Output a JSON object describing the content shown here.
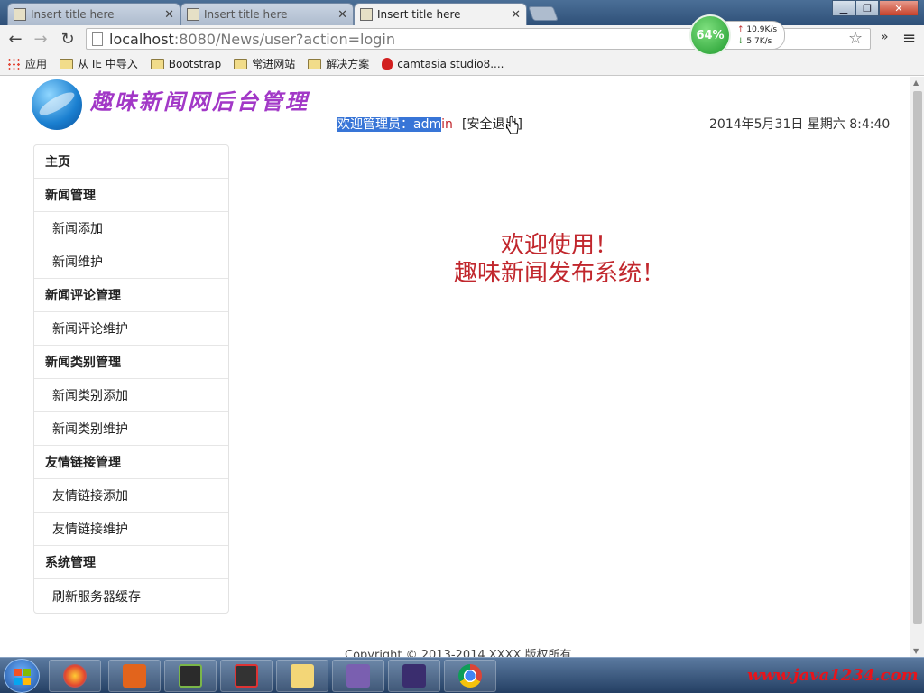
{
  "browser": {
    "tabs": [
      {
        "title": "Insert title here",
        "active": false
      },
      {
        "title": "Insert title here",
        "active": false
      },
      {
        "title": "Insert title here",
        "active": true
      }
    ],
    "url_host": "localhost",
    "url_path": ":8080/News/user?action=login",
    "bookmarks": [
      {
        "label": "应用",
        "icon": "apps-icon"
      },
      {
        "label": "从 IE 中导入",
        "icon": "folder-icon"
      },
      {
        "label": "Bootstrap",
        "icon": "folder-icon"
      },
      {
        "label": "常进网站",
        "icon": "folder-icon"
      },
      {
        "label": "解决方案",
        "icon": "folder-icon"
      },
      {
        "label": "camtasia studio8....",
        "icon": "camtasia-icon"
      }
    ],
    "speed_meter": {
      "percent": "64%",
      "up": "10.9K/s",
      "down": "5.7K/s"
    }
  },
  "header": {
    "site_title": "趣味新闻网后台管理",
    "welcome_selected": "欢迎管理员：adm",
    "welcome_rest": "in",
    "logout": "[安全退出]",
    "datetime": "2014年5月31日 星期六 8:4:40"
  },
  "sidebar": {
    "items": [
      {
        "label": "主页",
        "type": "header"
      },
      {
        "label": "新闻管理",
        "type": "header"
      },
      {
        "label": "新闻添加",
        "type": "sub"
      },
      {
        "label": "新闻维护",
        "type": "sub"
      },
      {
        "label": "新闻评论管理",
        "type": "header"
      },
      {
        "label": "新闻评论维护",
        "type": "sub"
      },
      {
        "label": "新闻类别管理",
        "type": "header"
      },
      {
        "label": "新闻类别添加",
        "type": "sub"
      },
      {
        "label": "新闻类别维护",
        "type": "sub"
      },
      {
        "label": "友情链接管理",
        "type": "header"
      },
      {
        "label": "友情链接添加",
        "type": "sub"
      },
      {
        "label": "友情链接维护",
        "type": "sub"
      },
      {
        "label": "系统管理",
        "type": "header"
      },
      {
        "label": "刷新服务器缓存",
        "type": "sub"
      }
    ]
  },
  "main": {
    "welcome_line1": "欢迎使用！",
    "welcome_line2": "趣味新闻发布系统！"
  },
  "footer": {
    "text": "Copyright © 2013-2014 XXXX 版权所有"
  },
  "taskbar": {
    "watermark": "www.java1234.com"
  },
  "colors": {
    "accent_red": "#c1272d",
    "title_purple": "#a238c7",
    "selection_blue": "#3875d7"
  }
}
